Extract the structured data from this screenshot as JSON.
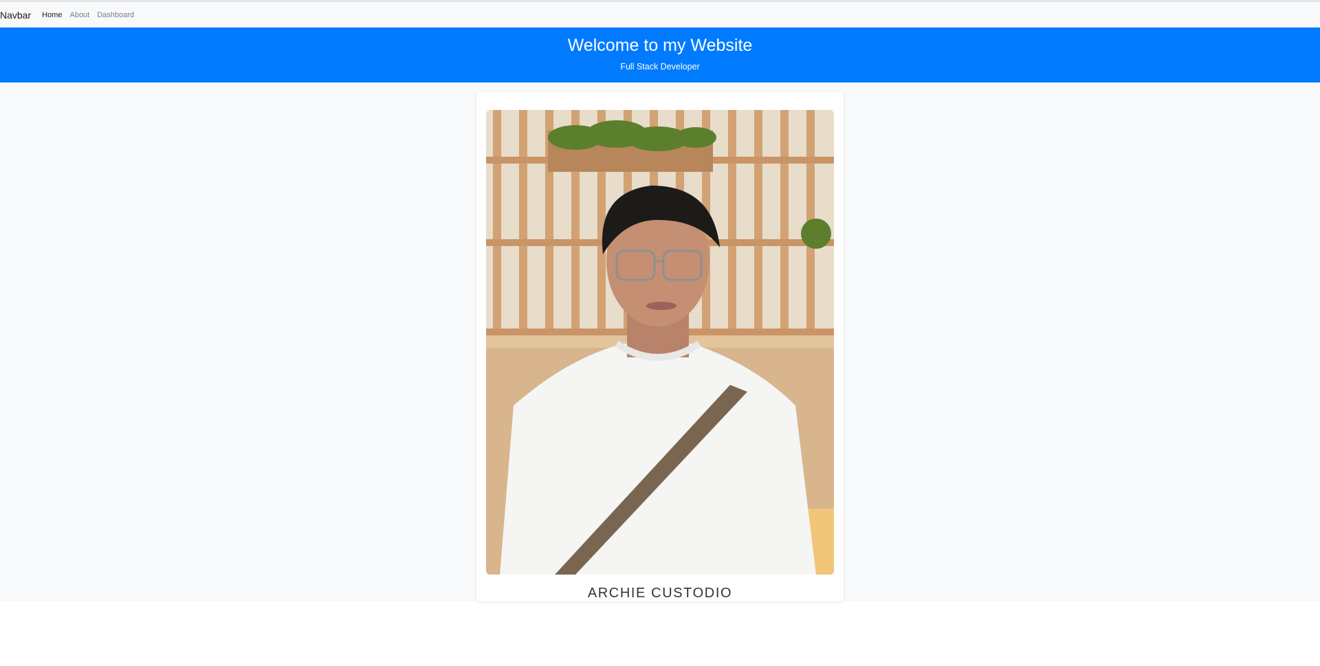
{
  "navbar": {
    "brand": "Navbar",
    "links": [
      {
        "label": "Home",
        "active": true
      },
      {
        "label": "About",
        "active": false
      },
      {
        "label": "Dashboard",
        "active": false
      }
    ]
  },
  "hero": {
    "title": "Welcome to my Website",
    "subtitle": "Full Stack Developer",
    "background_color": "#007bff"
  },
  "profile": {
    "name": "ARCHIE CUSTODIO",
    "photo_icon": "profile-photo"
  }
}
